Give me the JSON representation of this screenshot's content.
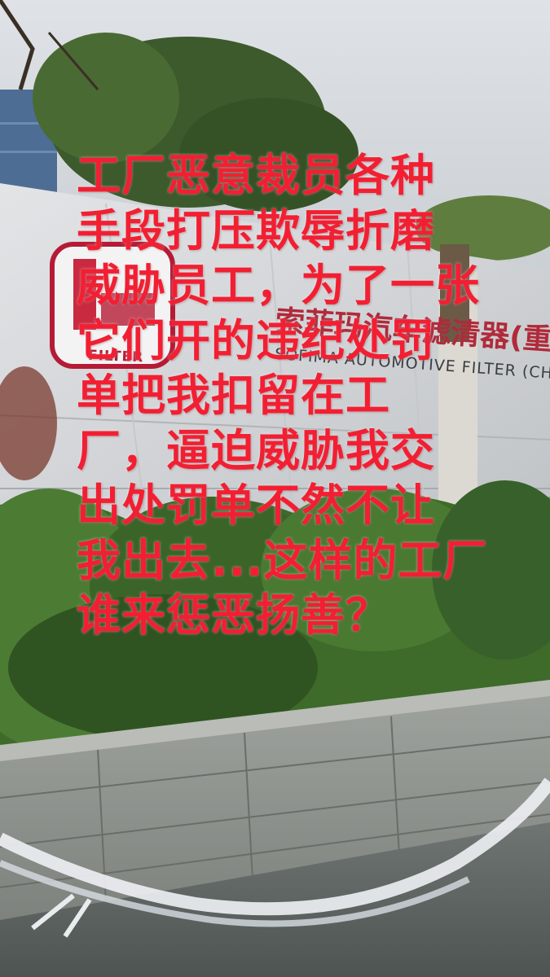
{
  "scene": {
    "description_colors": {
      "caption_text": "#f21f33",
      "logo_red": "#b51b35",
      "sign_red": "#b02a3a"
    }
  },
  "sign": {
    "logo_word": "FILTER",
    "chinese_name": "索菲玛汽车滤清器(重庆",
    "english_name": "SOFIMA AUTOMOTIVE FILTER (CHONG"
  },
  "caption": {
    "lines": [
      "工厂恶意裁员各种",
      "手段打压欺辱折磨",
      "威胁员工，为了一张",
      "它们开的违纪处罚",
      "单把我扣留在工",
      "厂，逼迫威胁我交",
      "出处罚单不然不让",
      "我出去...这样的工厂",
      "谁来惩恶扬善？"
    ]
  }
}
